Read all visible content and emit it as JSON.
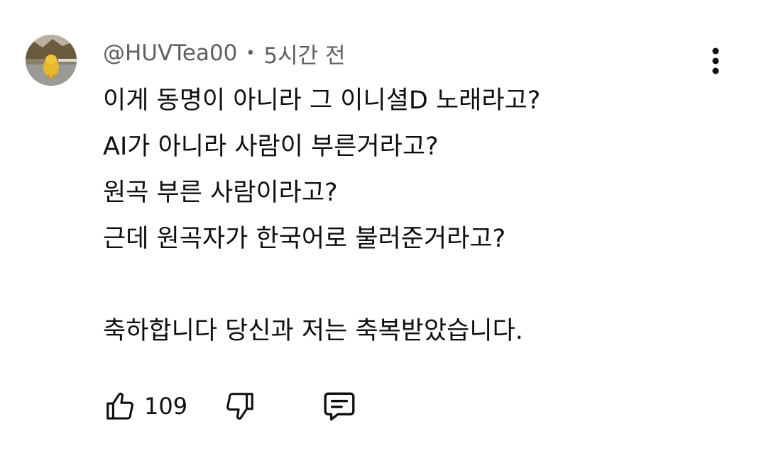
{
  "comment": {
    "author": "@HUVTea00",
    "separator": "•",
    "time": "5시간 전",
    "lines": [
      "이게 동명이 아니라 그 이니셜D 노래라고?",
      "AI가 아니라 사람이 부른거라고?",
      "원곡 부른 사람이라고?",
      "근데 원곡자가 한국어로 불러준거라고?",
      "",
      "축하합니다 당신과 저는 축복받았습니다."
    ],
    "like_count": "109"
  },
  "icons": {
    "avatar": "avatar-yellow-character",
    "more": "more-vertical-icon",
    "like": "thumb-up-icon",
    "dislike": "thumb-down-icon",
    "reply": "comment-icon"
  },
  "colors": {
    "text": "#0f0f0f",
    "meta": "#606060"
  }
}
